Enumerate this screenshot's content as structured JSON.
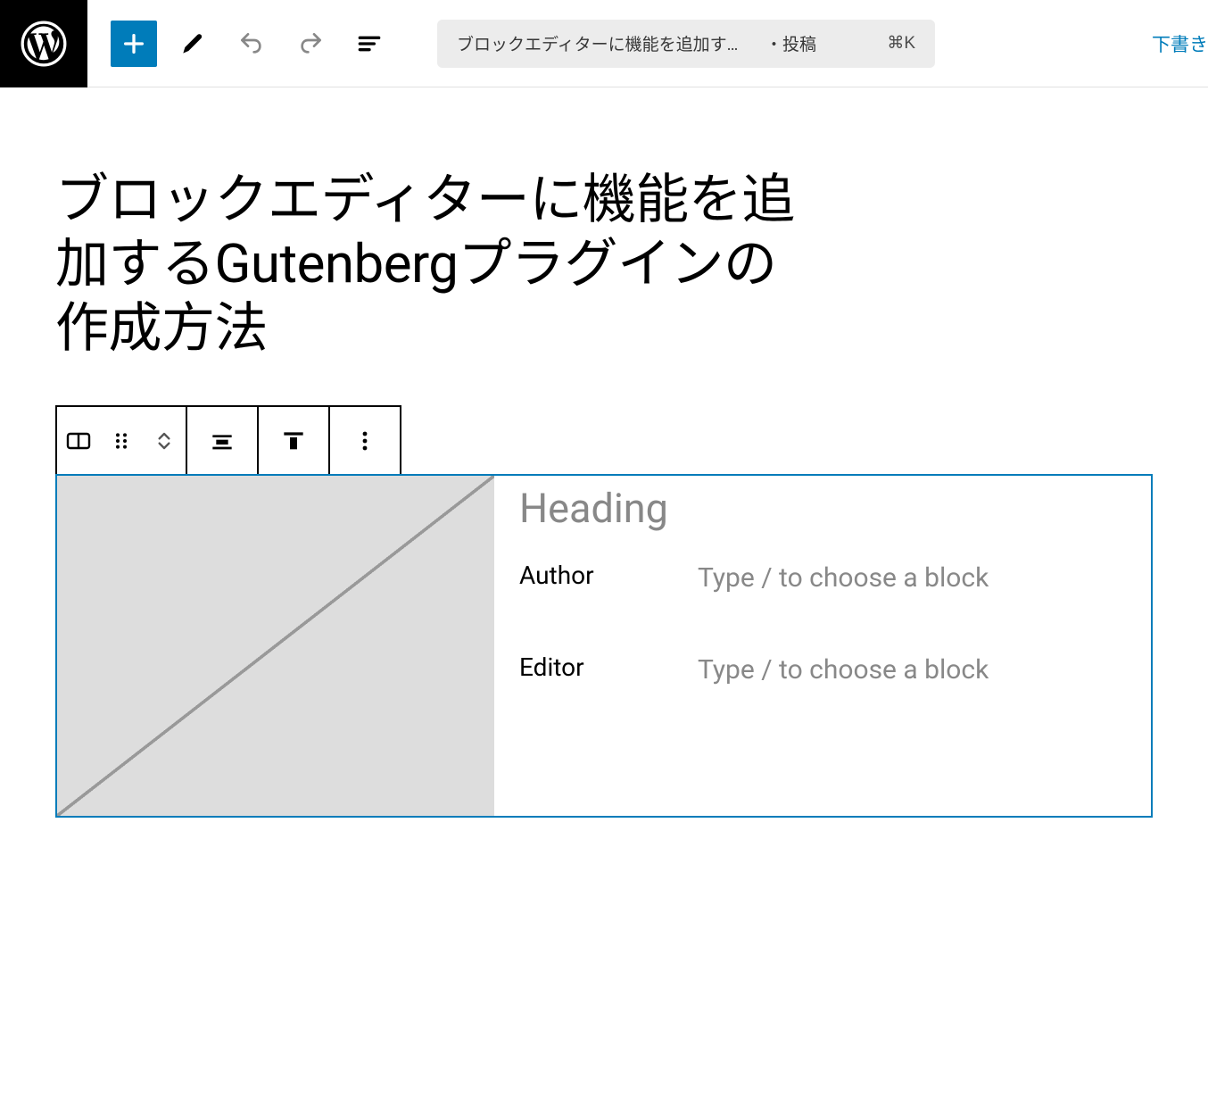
{
  "toolbar": {
    "document_title": "ブロックエディターに機能を追加する...",
    "document_type_prefix": "・",
    "document_type": "投稿",
    "shortcut": "⌘K",
    "draft_label": "下書き"
  },
  "post": {
    "title": "ブロックエディターに機能を追加するGutenbergプラグインの作成方法"
  },
  "block": {
    "heading_placeholder": "Heading",
    "rows": [
      {
        "label": "Author",
        "placeholder": "Type / to choose a block"
      },
      {
        "label": "Editor",
        "placeholder": "Type / to choose a block"
      }
    ]
  }
}
